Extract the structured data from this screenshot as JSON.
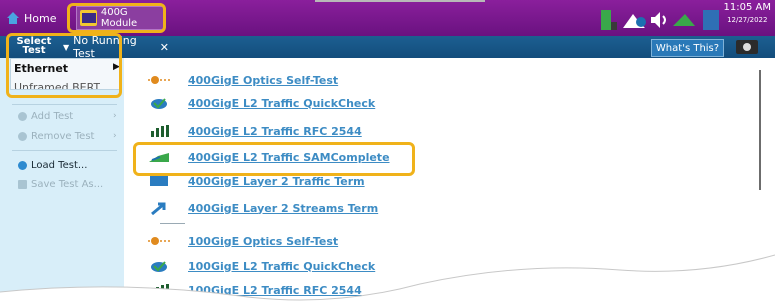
{
  "header": {
    "home_label": "Home",
    "module_label": "400G Module",
    "time": "11:05 AM",
    "date": "12/27/2022"
  },
  "toolbar": {
    "select_test_line1": "Select",
    "select_test_line2": "Test",
    "tab_label": "No Running Test",
    "tab_close": "✕",
    "whats_this": "What's This?"
  },
  "menu": {
    "ethernet": "Ethernet",
    "clipped_item": "Unframed BERT"
  },
  "sidebar": {
    "add_test": "Add Test",
    "remove_test": "Remove Test",
    "load_test": "Load Test...",
    "save_test": "Save Test As..."
  },
  "tests": [
    {
      "label": "400GigE Optics Self-Test",
      "icon": "optics-icon"
    },
    {
      "label": "400GigE L2 Traffic QuickCheck",
      "icon": "quickcheck-icon"
    },
    {
      "label": "400GigE L2 Traffic RFC 2544",
      "icon": "rfc2544-icon"
    },
    {
      "label": "400GigE L2 Traffic SAMComplete",
      "icon": "samcomplete-icon"
    },
    {
      "label": "400GigE Layer 2 Traffic Term",
      "icon": "traffic-term-icon"
    },
    {
      "label": "400GigE Layer 2 Streams Term",
      "icon": "streams-term-icon"
    },
    {
      "label": "100GigE Optics Self-Test",
      "icon": "optics-icon"
    },
    {
      "label": "100GigE L2 Traffic QuickCheck",
      "icon": "quickcheck-icon"
    },
    {
      "label": "100GigE L2 Traffic RFC 2544",
      "icon": "rfc2544-icon"
    }
  ],
  "colors": {
    "title_bar": "#7b1a90",
    "toolbar": "#1a5a8a",
    "sidebar": "#d8eef9",
    "link": "#3d8cc4",
    "callout": "#f0b21a"
  }
}
